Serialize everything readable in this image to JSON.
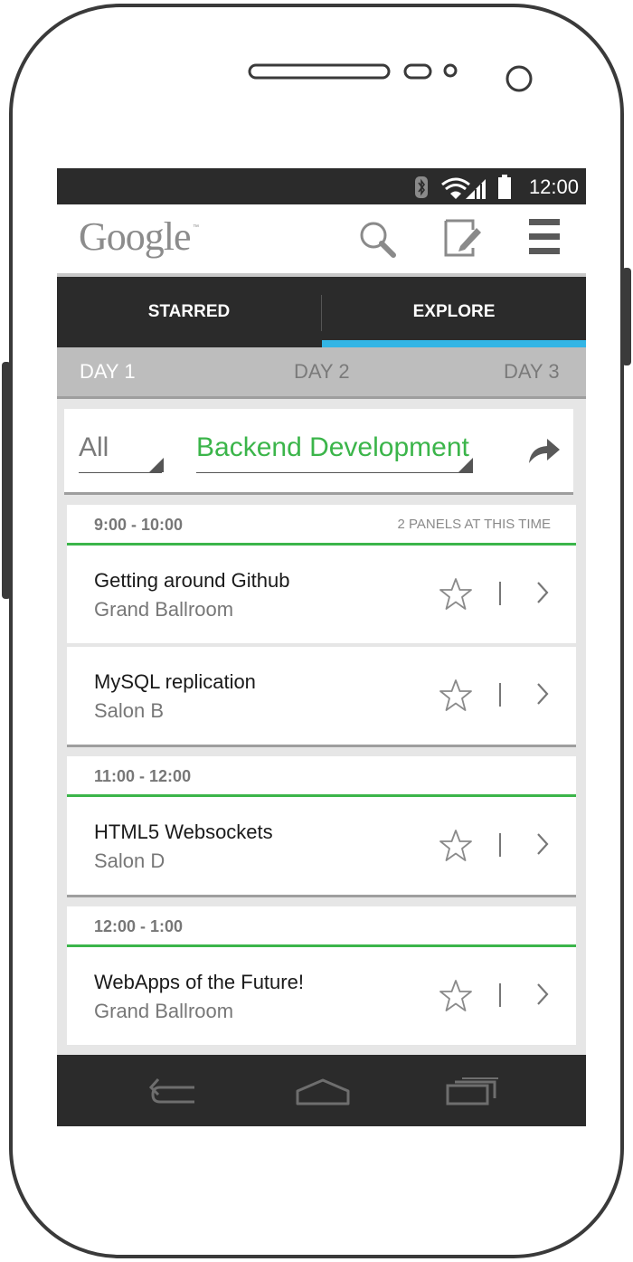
{
  "status_bar": {
    "time": "12:00"
  },
  "action_bar": {
    "logo": "Google",
    "logo_tm": "™",
    "search_icon": "search-icon",
    "edit_icon": "edit-note-icon",
    "menu_icon": "menu-icon"
  },
  "tabs": [
    {
      "label": "STARRED",
      "active": false
    },
    {
      "label": "EXPLORE",
      "active": true
    }
  ],
  "accent_colors": {
    "tab_indicator": "#33b5e5",
    "green": "#3bb54a"
  },
  "days": [
    {
      "label": "DAY 1",
      "active": true
    },
    {
      "label": "DAY 2",
      "active": false
    },
    {
      "label": "DAY 3",
      "active": false
    }
  ],
  "filter": {
    "scope": "All",
    "topic": "Backend Development",
    "share_icon": "share-icon"
  },
  "groups": [
    {
      "time": "9:00 - 10:00",
      "count": "2 PANELS AT THIS TIME",
      "sessions": [
        {
          "title": "Getting around Github",
          "room": "Grand Ballroom"
        },
        {
          "title": "MySQL replication",
          "room": "Salon B"
        }
      ]
    },
    {
      "time": "11:00 - 12:00",
      "sessions": [
        {
          "title": "HTML5 Websockets",
          "room": "Salon D"
        }
      ]
    },
    {
      "time": "12:00 - 1:00",
      "sessions": [
        {
          "title": "WebApps of the Future!",
          "room": "Grand Ballroom"
        }
      ]
    }
  ]
}
